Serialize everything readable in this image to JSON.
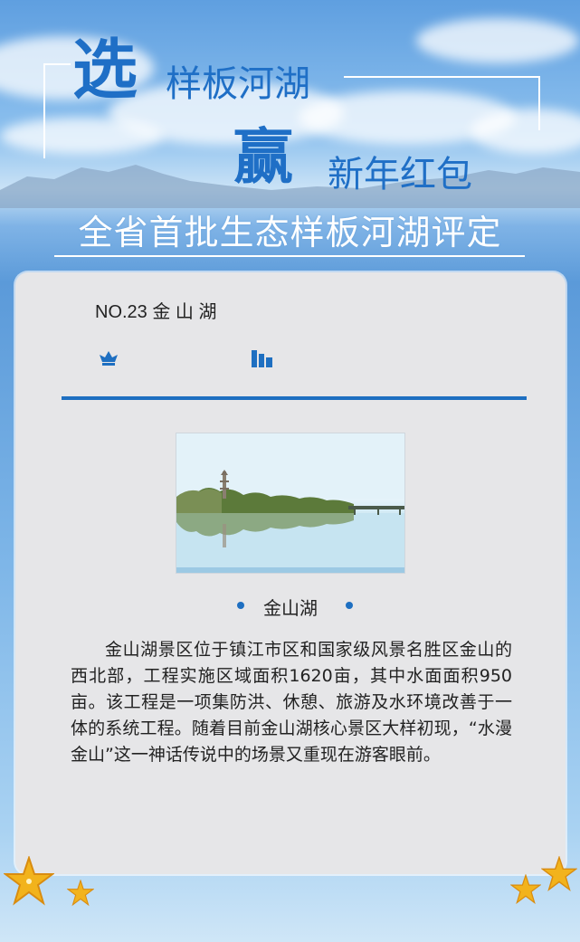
{
  "hero": {
    "char_select": "选",
    "line1_text": "样板河湖",
    "char_win": "赢",
    "line2_text": "新年红包",
    "banner": "全省首批生态样板河湖评定"
  },
  "card": {
    "title": "NO.23 金 山 湖",
    "photo_caption": "金山湖",
    "description": "金山湖景区位于镇江市区和国家级风景名胜区金山的西北部，工程实施区域面积1620亩，其中水面面积950亩。该工程是一项集防洪、休憩、旅游及水环境改善于一体的系统工程。随着目前金山湖核心景区大样初现，“水漫金山”这一神话传说中的场景又重现在游客眼前。"
  },
  "icons": [
    "crown-icon",
    "bar-chart-icon",
    "starfish-icon"
  ],
  "colors": {
    "accent": "#1e6fc1",
    "card_bg": "#e6e6e8",
    "banner_text": "#ffffff"
  }
}
